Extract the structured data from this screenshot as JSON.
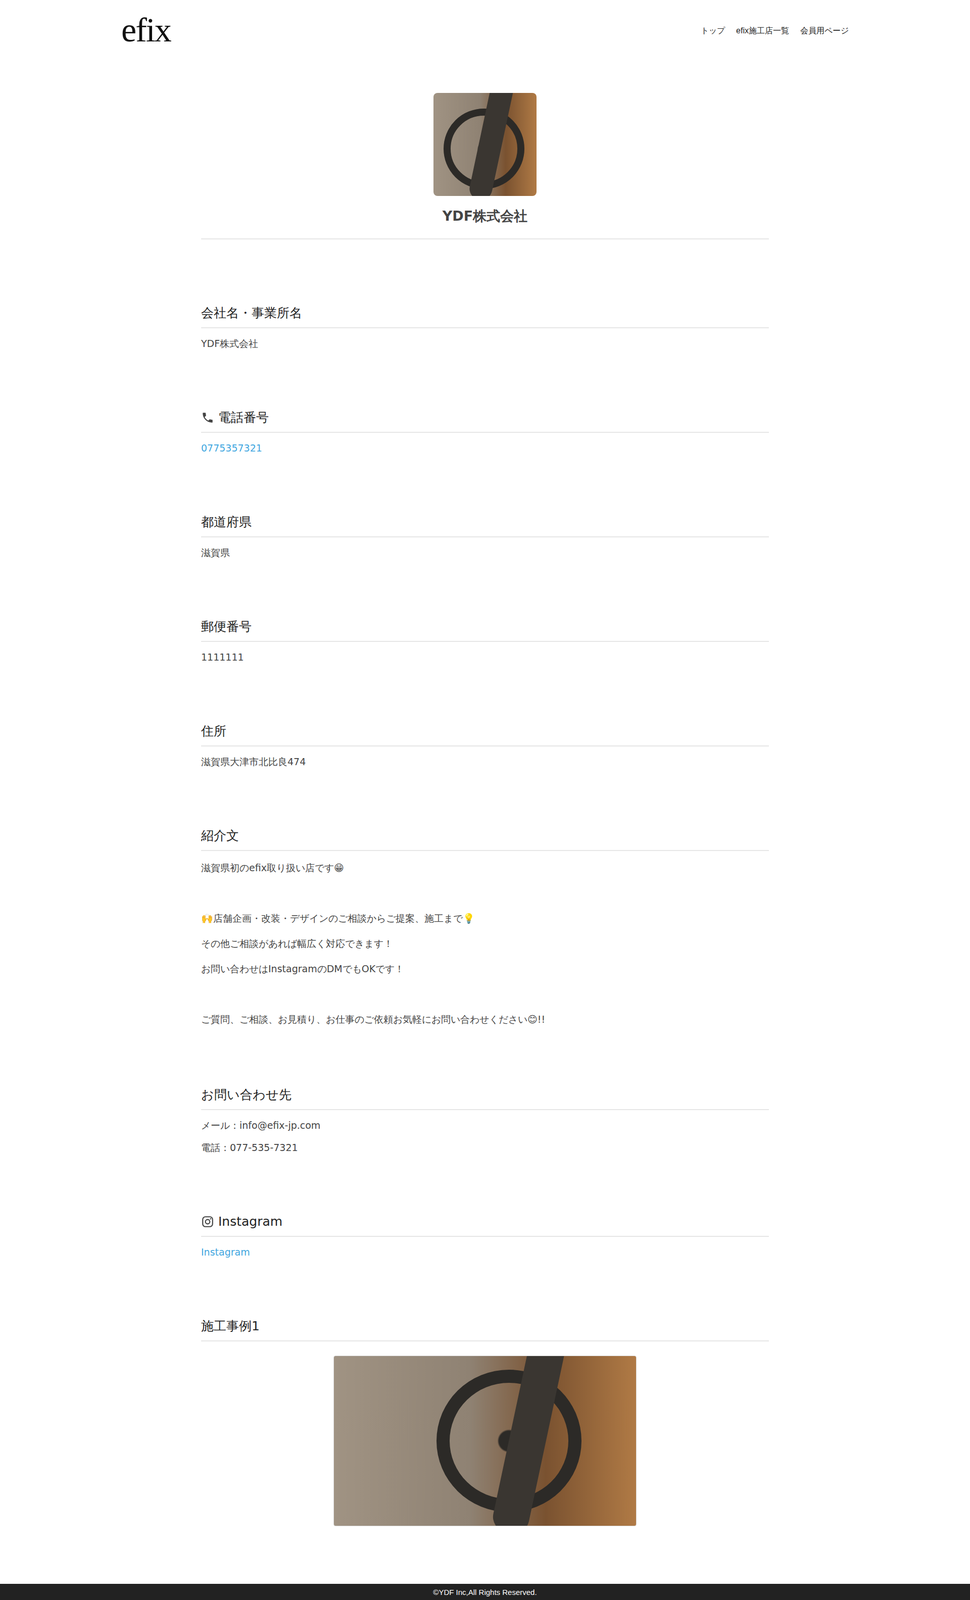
{
  "header": {
    "logo": "efix",
    "nav": [
      {
        "label": "トップ"
      },
      {
        "label": "efix施工店一覧"
      },
      {
        "label": "会員用ページ"
      }
    ]
  },
  "profile": {
    "name": "YDF株式会社"
  },
  "sections": [
    {
      "heading": "会社名・事業所名",
      "kind": "text",
      "paragraphs": [
        [
          "YDF株式会社"
        ]
      ]
    },
    {
      "heading": "電話番号",
      "kind": "phone",
      "paragraphs": [
        [
          "0775357321"
        ]
      ]
    },
    {
      "heading": "都道府県",
      "kind": "text",
      "paragraphs": [
        [
          "滋賀県"
        ]
      ]
    },
    {
      "heading": "郵便番号",
      "kind": "text",
      "paragraphs": [
        [
          "1111111"
        ]
      ]
    },
    {
      "heading": "住所",
      "kind": "text",
      "paragraphs": [
        [
          "滋賀県大津市北比良474"
        ]
      ]
    },
    {
      "heading": "紹介文",
      "kind": "text",
      "paragraphs": [
        [
          "滋賀県初のefix取り扱い店です😁"
        ],
        [
          "🙌店舗企画・改装・デザインのご相談からご提案、施工まで💡",
          "その他ご相談があれば幅広く対応できます！",
          "お問い合わせはInstagramのDMでもOKです！"
        ],
        [
          "ご質問、ご相談、お見積り、お仕事のご依頼お気軽にお問い合わせください😊!!"
        ]
      ]
    },
    {
      "heading": "お問い合わせ先",
      "kind": "text",
      "paragraphs": [
        [
          "メール：info@efix-jp.com",
          "電話：077-535-7321"
        ]
      ]
    },
    {
      "heading": "Instagram",
      "kind": "instagram",
      "paragraphs": [
        [
          "Instagram"
        ]
      ]
    },
    {
      "heading": "施工事例1",
      "kind": "image",
      "paragraphs": []
    }
  ],
  "footer": {
    "copyright": "©YDF Inc,All Rights Reserved."
  }
}
